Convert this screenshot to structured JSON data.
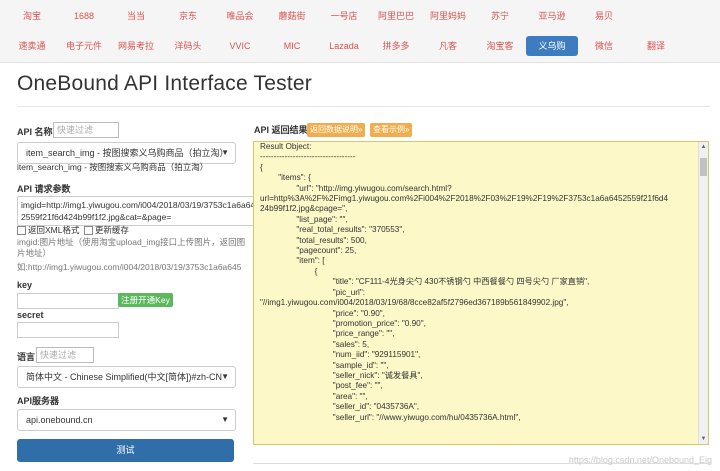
{
  "nav": {
    "row1": [
      "淘宝",
      "1688",
      "当当",
      "京东",
      "唯品会",
      "蘑菇街",
      "一号店",
      "阿里巴巴",
      "阿里妈妈",
      "苏宁",
      "亚马逊",
      "易贝"
    ],
    "row2": [
      "速卖通",
      "电子元件",
      "网易考拉",
      "洋码头",
      "VVIC",
      "MIC",
      "Lazada",
      "拼多多",
      "凡客",
      "淘宝客",
      "义乌购",
      "微信",
      "翻译"
    ],
    "active": "义乌购"
  },
  "page": {
    "title": "OneBound API Interface Tester"
  },
  "form": {
    "api_name_label": "API 名称",
    "filter_placeholder": "快速过滤",
    "api_select_value": "item_search_img - 按图搜索义乌购商品（拍立淘）",
    "api_desc": "item_search_img - 按图搜索义乌购商品（拍立淘）",
    "params_label": "API 请求参数",
    "params_value": "imgid=http://img1.yiwugou.com/i004/2018/03/19/3753c1a6a6452559f21f6d424b99f1f2.jpg&cat=&page=",
    "xml_checkbox": "返回XML格式",
    "cache_checkbox": "更新缓存",
    "imgid_help": "imgid:图片地址（使用淘宝upload_img接口上传图片，返回图片地址）",
    "imgid_example": "如:http://img1.yiwugou.com/i004/2018/03/19/3753c1a6a645",
    "key_label": "key",
    "register_button": "注册开通Key",
    "secret_label": "secret",
    "lang_label": "语言",
    "lang_value": "简体中文 - Chinese Simplified(中文[简体])#zh-CN",
    "server_label": "API服务器",
    "server_value": "api.onebound.cn",
    "test_button": "测试"
  },
  "result": {
    "label": "API 返回结果",
    "doc_button": "返回数据说明»",
    "example_button": "查看示例»",
    "lines": [
      "Result Object:",
      "-----------------------------------",
      "{",
      "        \"items\": {",
      "                \"url\": \"http://img.yiwugou.com/search.html?",
      "url=http%3A%2F%2Fimg1.yiwugou.com%2Fi004%2F2018%2F03%2F19%2F19%2F3753c1a6a6452559f21f6d4",
      "24b99f1f2.jpg&cpage=\",",
      "                \"list_page\": \"\",",
      "                \"real_total_results\": \"370553\",",
      "                \"total_results\": 500,",
      "                \"pagecount\": 25,",
      "                \"item\": [",
      "                        {",
      "                                \"title\": \"CF111-4光身尖勺 430不锈钢勺 中西餐餐勺 四号尖勺 厂家直销\",",
      "                                \"pic_url\":",
      "\"//img1.yiwugou.com/i004/2018/03/19/68/8cce82af5f2796ed367189b561849902.jpg\",",
      "                                \"price\": \"0.90\",",
      "                                \"promotion_price\": \"0.90\",",
      "                                \"price_range\": \"\",",
      "                                \"sales\": 5,",
      "                                \"num_iid\": \"929115901\",",
      "                                \"sample_id\": \"\",",
      "                                \"seller_nick\": \"诚发餐具\",",
      "                                \"post_fee\": \"\",",
      "                                \"area\": \"\",",
      "                                \"seller_id\": \"0435736A\",",
      "                                \"seller_url\": \"//www.yiwugo.com/hu/0435736A.html\","
    ]
  },
  "watermark": "https://blog.csdn.net/Onebound_Eig"
}
